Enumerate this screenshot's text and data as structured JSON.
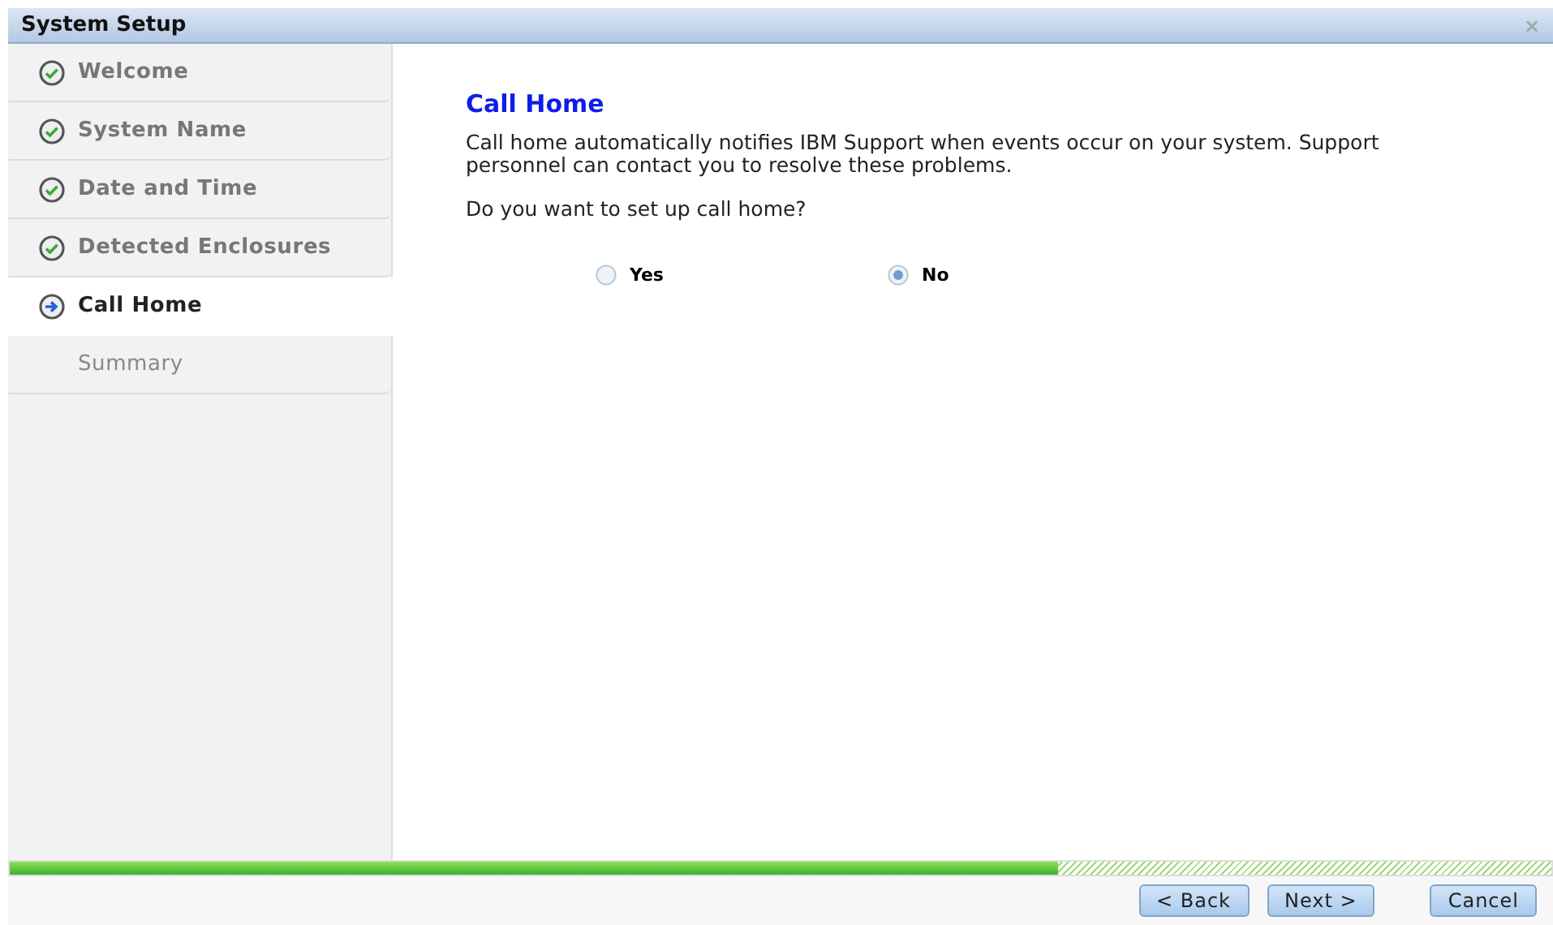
{
  "window": {
    "title": "System Setup",
    "close": "×"
  },
  "steps": [
    {
      "label": "Welcome",
      "kind": "done",
      "selected": false
    },
    {
      "label": "System Name",
      "kind": "done",
      "selected": false
    },
    {
      "label": "Date and Time",
      "kind": "done",
      "selected": false
    },
    {
      "label": "Detected Enclosures",
      "kind": "done",
      "selected": false
    },
    {
      "label": "Call Home",
      "kind": "current",
      "selected": true
    },
    {
      "label": "Summary",
      "kind": "pending",
      "selected": false
    }
  ],
  "content": {
    "heading": "Call Home",
    "description": "Call home automatically notifies IBM Support when events occur on your system. Support personnel can contact you to resolve these problems.",
    "question": "Do you want to set up call home?",
    "options": [
      {
        "label": "Yes",
        "selected": false
      },
      {
        "label": "No",
        "selected": true
      }
    ]
  },
  "progress": {
    "level": 0.68
  },
  "buttons": [
    {
      "label": "< Back",
      "kind": "nav"
    },
    {
      "label": "Next >",
      "kind": "nav"
    },
    {
      "label": "Cancel",
      "kind": "cancel"
    }
  ]
}
